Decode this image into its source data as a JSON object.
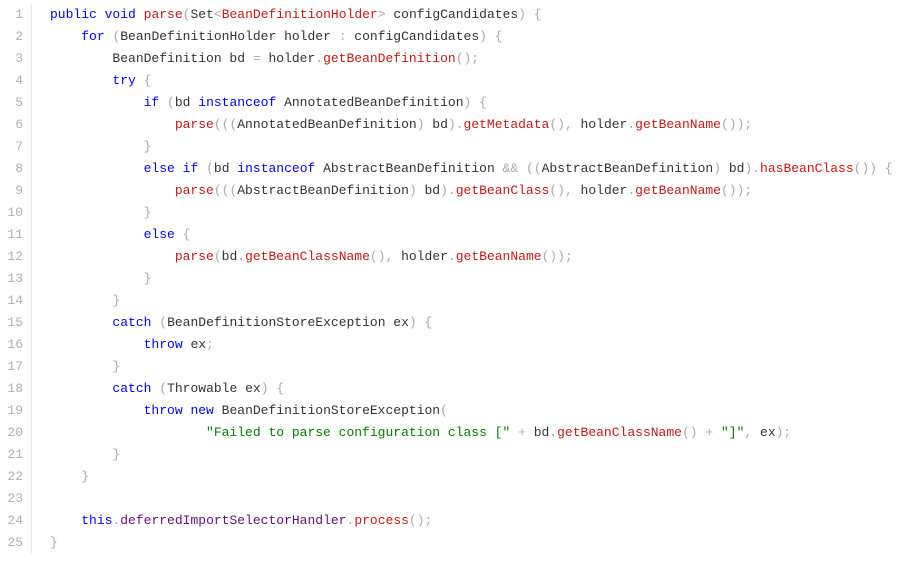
{
  "gutter": {
    "lines": [
      "1",
      "2",
      "3",
      "4",
      "5",
      "6",
      "7",
      "8",
      "9",
      "10",
      "11",
      "12",
      "13",
      "14",
      "15",
      "16",
      "17",
      "18",
      "19",
      "20",
      "21",
      "22",
      "23",
      "24",
      "25"
    ]
  },
  "code": {
    "tokens": [
      [
        [
          "kw",
          "public"
        ],
        [
          "ident",
          " "
        ],
        [
          "kw",
          "void"
        ],
        [
          "ident",
          " "
        ],
        [
          "method",
          "parse"
        ],
        [
          "punct",
          "("
        ],
        [
          "ident",
          "Set"
        ],
        [
          "punct",
          "<"
        ],
        [
          "type",
          "BeanDefinitionHolder"
        ],
        [
          "punct",
          ">"
        ],
        [
          "ident",
          " configCandidates"
        ],
        [
          "punct",
          ")"
        ],
        [
          "ident",
          " "
        ],
        [
          "punct",
          "{"
        ]
      ],
      [
        [
          "ident",
          "    "
        ],
        [
          "kw",
          "for"
        ],
        [
          "ident",
          " "
        ],
        [
          "punct",
          "("
        ],
        [
          "ident",
          "BeanDefinitionHolder holder "
        ],
        [
          "punct",
          ":"
        ],
        [
          "ident",
          " configCandidates"
        ],
        [
          "punct",
          ")"
        ],
        [
          "ident",
          " "
        ],
        [
          "punct",
          "{"
        ]
      ],
      [
        [
          "ident",
          "        BeanDefinition bd "
        ],
        [
          "punct",
          "="
        ],
        [
          "ident",
          " holder"
        ],
        [
          "punct",
          "."
        ],
        [
          "method",
          "getBeanDefinition"
        ],
        [
          "punct",
          "();"
        ]
      ],
      [
        [
          "ident",
          "        "
        ],
        [
          "kw",
          "try"
        ],
        [
          "ident",
          " "
        ],
        [
          "punct",
          "{"
        ]
      ],
      [
        [
          "ident",
          "            "
        ],
        [
          "kw",
          "if"
        ],
        [
          "ident",
          " "
        ],
        [
          "punct",
          "("
        ],
        [
          "ident",
          "bd "
        ],
        [
          "kw",
          "instanceof"
        ],
        [
          "ident",
          " AnnotatedBeanDefinition"
        ],
        [
          "punct",
          ")"
        ],
        [
          "ident",
          " "
        ],
        [
          "punct",
          "{"
        ]
      ],
      [
        [
          "ident",
          "                "
        ],
        [
          "method",
          "parse"
        ],
        [
          "punct",
          "((("
        ],
        [
          "ident",
          "AnnotatedBeanDefinition"
        ],
        [
          "punct",
          ")"
        ],
        [
          "ident",
          " bd"
        ],
        [
          "punct",
          ")."
        ],
        [
          "method",
          "getMetadata"
        ],
        [
          "punct",
          "(),"
        ],
        [
          "ident",
          " holder"
        ],
        [
          "punct",
          "."
        ],
        [
          "method",
          "getBeanName"
        ],
        [
          "punct",
          "());"
        ]
      ],
      [
        [
          "ident",
          "            "
        ],
        [
          "punct",
          "}"
        ]
      ],
      [
        [
          "ident",
          "            "
        ],
        [
          "kw",
          "else"
        ],
        [
          "ident",
          " "
        ],
        [
          "kw",
          "if"
        ],
        [
          "ident",
          " "
        ],
        [
          "punct",
          "("
        ],
        [
          "ident",
          "bd "
        ],
        [
          "kw",
          "instanceof"
        ],
        [
          "ident",
          " AbstractBeanDefinition "
        ],
        [
          "punct",
          "&&"
        ],
        [
          "ident",
          " "
        ],
        [
          "punct",
          "(("
        ],
        [
          "ident",
          "AbstractBeanDefinition"
        ],
        [
          "punct",
          ")"
        ],
        [
          "ident",
          " bd"
        ],
        [
          "punct",
          ")."
        ],
        [
          "method",
          "hasBeanClass"
        ],
        [
          "punct",
          "())"
        ],
        [
          "ident",
          " "
        ],
        [
          "punct",
          "{"
        ]
      ],
      [
        [
          "ident",
          "                "
        ],
        [
          "method",
          "parse"
        ],
        [
          "punct",
          "((("
        ],
        [
          "ident",
          "AbstractBeanDefinition"
        ],
        [
          "punct",
          ")"
        ],
        [
          "ident",
          " bd"
        ],
        [
          "punct",
          ")."
        ],
        [
          "method",
          "getBeanClass"
        ],
        [
          "punct",
          "(),"
        ],
        [
          "ident",
          " holder"
        ],
        [
          "punct",
          "."
        ],
        [
          "method",
          "getBeanName"
        ],
        [
          "punct",
          "());"
        ]
      ],
      [
        [
          "ident",
          "            "
        ],
        [
          "punct",
          "}"
        ]
      ],
      [
        [
          "ident",
          "            "
        ],
        [
          "kw",
          "else"
        ],
        [
          "ident",
          " "
        ],
        [
          "punct",
          "{"
        ]
      ],
      [
        [
          "ident",
          "                "
        ],
        [
          "method",
          "parse"
        ],
        [
          "punct",
          "("
        ],
        [
          "ident",
          "bd"
        ],
        [
          "punct",
          "."
        ],
        [
          "method",
          "getBeanClassName"
        ],
        [
          "punct",
          "(),"
        ],
        [
          "ident",
          " holder"
        ],
        [
          "punct",
          "."
        ],
        [
          "method",
          "getBeanName"
        ],
        [
          "punct",
          "());"
        ]
      ],
      [
        [
          "ident",
          "            "
        ],
        [
          "punct",
          "}"
        ]
      ],
      [
        [
          "ident",
          "        "
        ],
        [
          "punct",
          "}"
        ]
      ],
      [
        [
          "ident",
          "        "
        ],
        [
          "kw",
          "catch"
        ],
        [
          "ident",
          " "
        ],
        [
          "punct",
          "("
        ],
        [
          "ident",
          "BeanDefinitionStoreException ex"
        ],
        [
          "punct",
          ")"
        ],
        [
          "ident",
          " "
        ],
        [
          "punct",
          "{"
        ]
      ],
      [
        [
          "ident",
          "            "
        ],
        [
          "kw",
          "throw"
        ],
        [
          "ident",
          " ex"
        ],
        [
          "punct",
          ";"
        ]
      ],
      [
        [
          "ident",
          "        "
        ],
        [
          "punct",
          "}"
        ]
      ],
      [
        [
          "ident",
          "        "
        ],
        [
          "kw",
          "catch"
        ],
        [
          "ident",
          " "
        ],
        [
          "punct",
          "("
        ],
        [
          "ident",
          "Throwable ex"
        ],
        [
          "punct",
          ")"
        ],
        [
          "ident",
          " "
        ],
        [
          "punct",
          "{"
        ]
      ],
      [
        [
          "ident",
          "            "
        ],
        [
          "kw",
          "throw"
        ],
        [
          "ident",
          " "
        ],
        [
          "kw",
          "new"
        ],
        [
          "ident",
          " BeanDefinitionStoreException"
        ],
        [
          "punct",
          "("
        ]
      ],
      [
        [
          "ident",
          "                    "
        ],
        [
          "str",
          "\"Failed to parse configuration class [\""
        ],
        [
          "ident",
          " "
        ],
        [
          "punct",
          "+"
        ],
        [
          "ident",
          " bd"
        ],
        [
          "punct",
          "."
        ],
        [
          "method",
          "getBeanClassName"
        ],
        [
          "punct",
          "()"
        ],
        [
          "ident",
          " "
        ],
        [
          "punct",
          "+"
        ],
        [
          "ident",
          " "
        ],
        [
          "str",
          "\"]\""
        ],
        [
          "punct",
          ","
        ],
        [
          "ident",
          " ex"
        ],
        [
          "punct",
          ");"
        ]
      ],
      [
        [
          "ident",
          "        "
        ],
        [
          "punct",
          "}"
        ]
      ],
      [
        [
          "ident",
          "    "
        ],
        [
          "punct",
          "}"
        ]
      ],
      [
        [
          "ident",
          ""
        ]
      ],
      [
        [
          "ident",
          "    "
        ],
        [
          "kw",
          "this"
        ],
        [
          "punct",
          "."
        ],
        [
          "field",
          "deferredImportSelectorHandler"
        ],
        [
          "punct",
          "."
        ],
        [
          "method",
          "process"
        ],
        [
          "punct",
          "();"
        ]
      ],
      [
        [
          "punct",
          "}"
        ]
      ]
    ]
  }
}
